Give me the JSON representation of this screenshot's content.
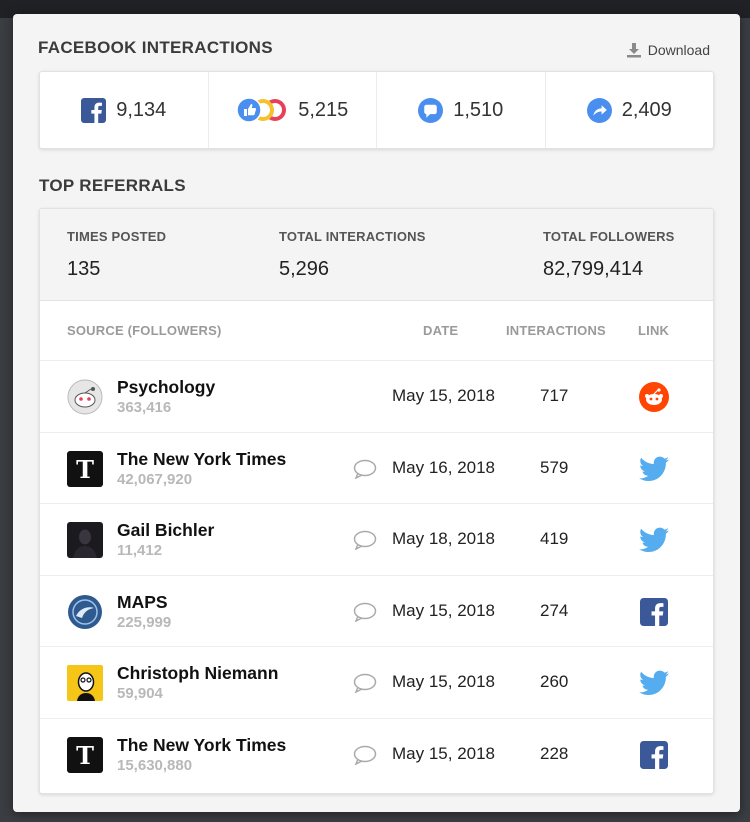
{
  "header": {
    "title": "FACEBOOK INTERACTIONS",
    "download_label": "Download"
  },
  "stats": [
    {
      "icon": "facebook-icon",
      "value": "9,134"
    },
    {
      "icon": "reactions-icon",
      "value": "5,215"
    },
    {
      "icon": "comment-icon",
      "value": "1,510"
    },
    {
      "icon": "share-icon",
      "value": "2,409"
    }
  ],
  "referrals": {
    "title": "TOP REFERRALS",
    "summary": {
      "times_posted_label": "TIMES POSTED",
      "times_posted": "135",
      "total_interactions_label": "TOTAL INTERACTIONS",
      "total_interactions": "5,296",
      "total_followers_label": "TOTAL FOLLOWERS",
      "total_followers": "82,799,414"
    },
    "columns": {
      "source": "SOURCE (FOLLOWERS)",
      "date": "DATE",
      "interactions": "INTERACTIONS",
      "link": "LINK"
    },
    "rows": [
      {
        "name": "Psychology",
        "followers": "363,416",
        "date": "May 15, 2018",
        "interactions": "717",
        "link": "reddit-icon",
        "avatar": "reddit-avatar",
        "comment": false
      },
      {
        "name": "The New York Times",
        "followers": "42,067,920",
        "date": "May 16, 2018",
        "interactions": "579",
        "link": "twitter-icon",
        "avatar": "nyt-avatar",
        "comment": true
      },
      {
        "name": "Gail Bichler",
        "followers": "11,412",
        "date": "May 18, 2018",
        "interactions": "419",
        "link": "twitter-icon",
        "avatar": "photo-avatar",
        "comment": true
      },
      {
        "name": "MAPS",
        "followers": "225,999",
        "date": "May 15, 2018",
        "interactions": "274",
        "link": "facebook-icon",
        "avatar": "maps-avatar",
        "comment": true
      },
      {
        "name": "Christoph Niemann",
        "followers": "59,904",
        "date": "May 15, 2018",
        "interactions": "260",
        "link": "twitter-icon",
        "avatar": "illustration-avatar",
        "comment": true
      },
      {
        "name": "The New York Times",
        "followers": "15,630,880",
        "date": "May 15, 2018",
        "interactions": "228",
        "link": "facebook-icon",
        "avatar": "nyt-avatar",
        "comment": true
      }
    ]
  },
  "colors": {
    "facebook": "#3b5998",
    "messenger": "#4a8ef0",
    "twitter": "#55acee",
    "reddit": "#ff4500"
  }
}
